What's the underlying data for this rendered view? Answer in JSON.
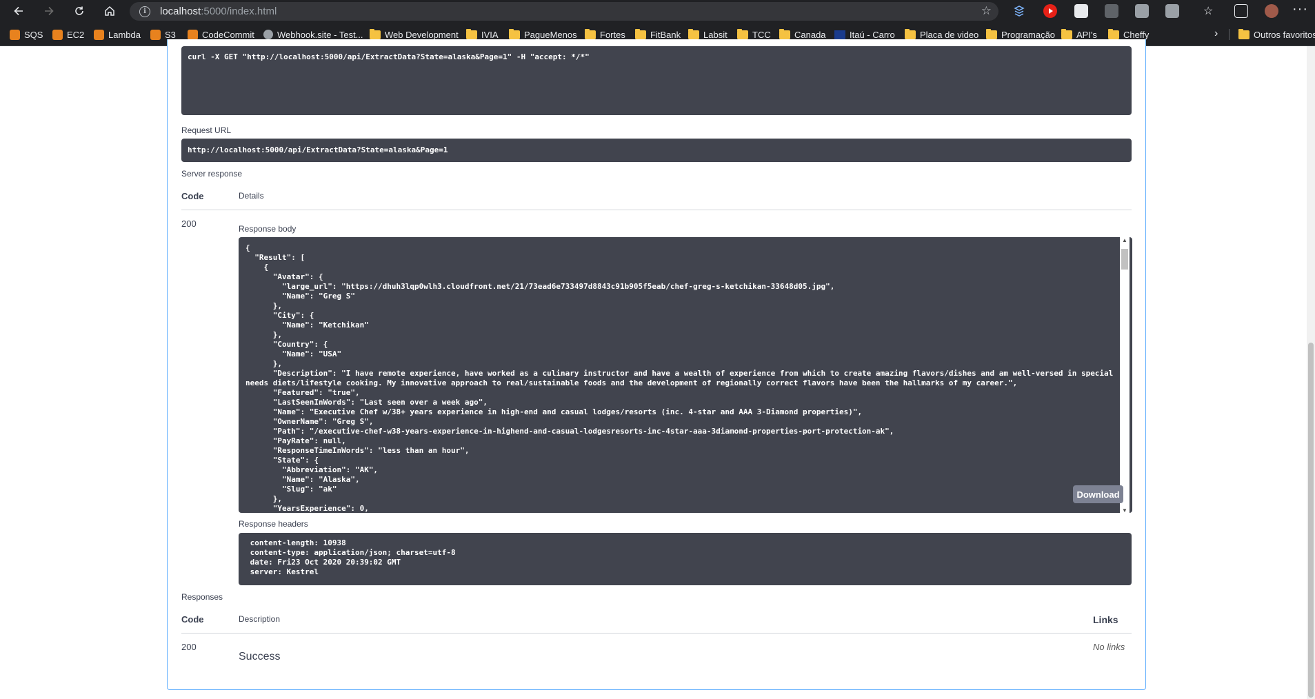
{
  "browser": {
    "url_host": "localhost",
    "url_rest": ":5000/index.html",
    "bookmarks": [
      "SQS",
      "EC2",
      "Lambda",
      "S3",
      "CodeCommit",
      "Webhook.site - Test...",
      "Web Development",
      "IVIA",
      "PagueMenos",
      "Fortes",
      "FitBank",
      "Labsit",
      "TCC",
      "Canada",
      "Itaú - Carro",
      "Placa de video",
      "Programação",
      "API's",
      "Cheffy"
    ],
    "other_bookmarks": "Outros favoritos"
  },
  "curl": {
    "command": "curl -X GET \"http://localhost:5000/api/ExtractData?State=alaska&Page=1\" -H \"accept: */*\""
  },
  "request_url": {
    "label": "Request URL",
    "value": "http://localhost:5000/api/ExtractData?State=alaska&Page=1"
  },
  "server_response": {
    "label": "Server response",
    "col_code": "Code",
    "col_details": "Details",
    "code": "200",
    "body_label": "Response body",
    "body": "{\n  \"Result\": [\n    {\n      \"Avatar\": {\n        \"large_url\": \"https://dhuh3lqp0wlh3.cloudfront.net/21/73ead6e733497d8843c91b905f5eab/chef-greg-s-ketchikan-33648d05.jpg\",\n        \"Name\": \"Greg S\"\n      },\n      \"City\": {\n        \"Name\": \"Ketchikan\"\n      },\n      \"Country\": {\n        \"Name\": \"USA\"\n      },\n      \"Description\": \"I have remote experience, have worked as a culinary instructor and have a wealth of experience from which to create amazing flavors/dishes and am well-versed in special needs diets/lifestyle cooking. My innovative approach to real/sustainable foods and the development of regionally correct flavors have been the hallmarks of my career.\",\n      \"Featured\": \"true\",\n      \"LastSeenInWords\": \"Last seen over a week ago\",\n      \"Name\": \"Executive Chef w/38+ years experience in high-end and casual lodges/resorts (inc. 4-star and AAA 3-Diamond properties)\",\n      \"OwnerName\": \"Greg S\",\n      \"Path\": \"/executive-chef-w38-years-experience-in-highend-and-casual-lodgesresorts-inc-4star-aaa-3diamond-properties-port-protection-ak\",\n      \"PayRate\": null,\n      \"ResponseTimeInWords\": \"less than an hour\",\n      \"State\": {\n        \"Abbreviation\": \"AK\",\n        \"Name\": \"Alaska\",\n        \"Slug\": \"ak\"\n      },\n      \"YearsExperience\": 0,",
    "download_label": "Download",
    "headers_label": "Response headers",
    "headers": " content-length: 10938 \n content-type: application/json; charset=utf-8 \n date: Fri23 Oct 2020 20:39:02 GMT \n server: Kestrel "
  },
  "responses": {
    "label": "Responses",
    "col_code": "Code",
    "col_description": "Description",
    "col_links": "Links",
    "code": "200",
    "description": "Success",
    "links": "No links"
  }
}
